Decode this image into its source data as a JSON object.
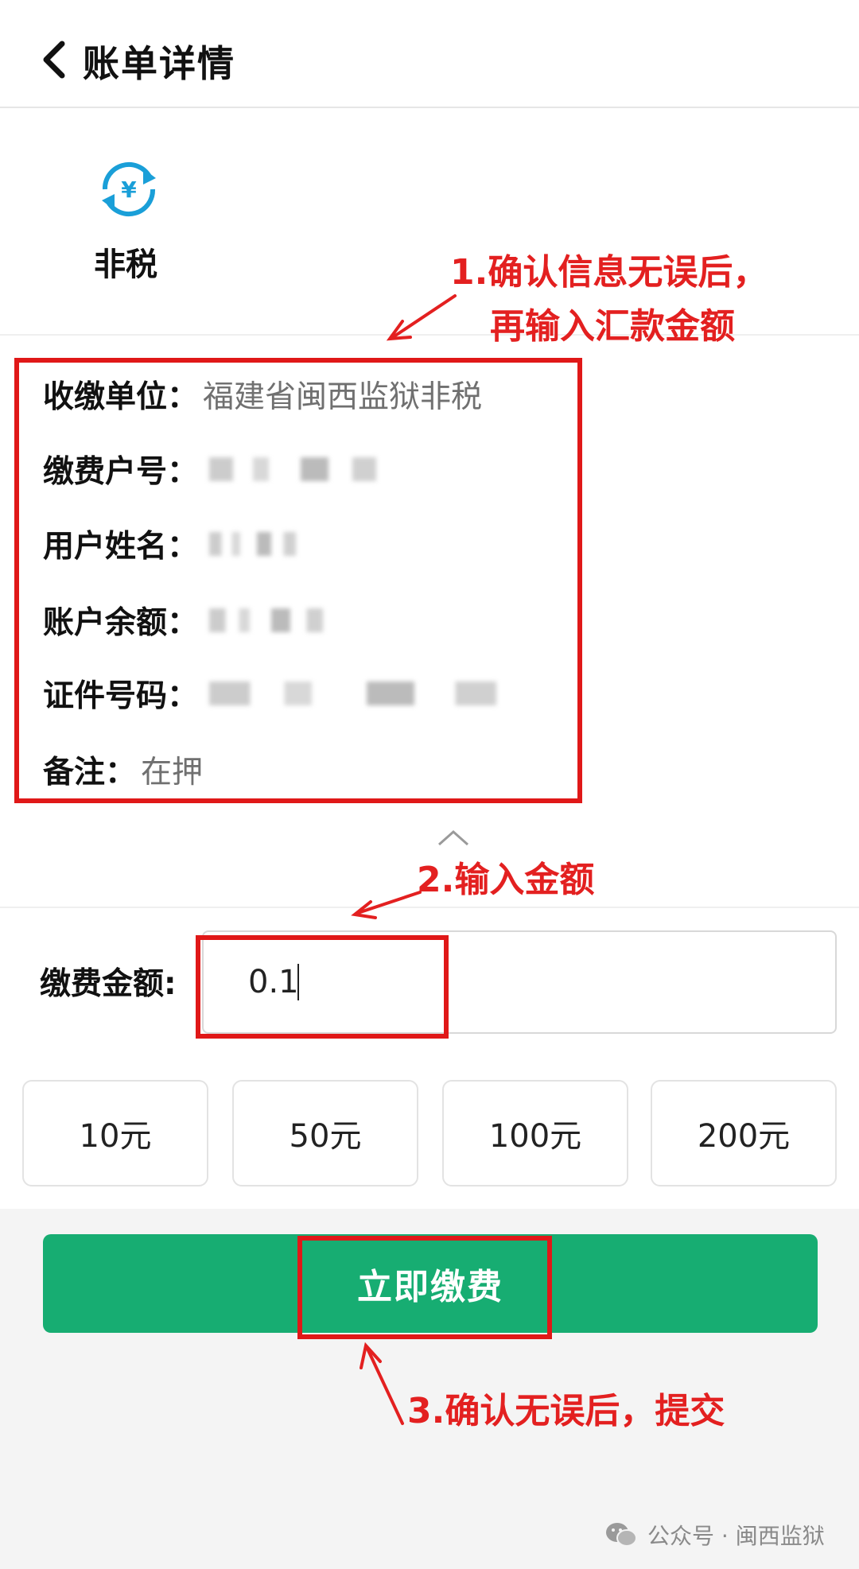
{
  "header": {
    "title": "账单详情",
    "back_icon": "chevron-left-icon"
  },
  "bill_type": {
    "label": "非税",
    "icon": "currency-exchange-icon",
    "icon_color": "#1a9fd8"
  },
  "annotations": {
    "note1_line1": "1.确认信息无误后，",
    "note1_line2": "再输入汇款金额",
    "note2": "2.输入金额",
    "note3": "3.确认无误后，提交",
    "color": "#e32020"
  },
  "info": {
    "unit_label": "收缴单位：",
    "unit_value": "福建省闽西监狱非税",
    "account_label": "缴费户号：",
    "name_label": "用户姓名：",
    "balance_label": "账户余额：",
    "id_label": "证件号码：",
    "remark_label": "备注：",
    "remark_value": "在押"
  },
  "amount": {
    "label": "缴费金额:",
    "value": "0.1"
  },
  "presets": [
    "10元",
    "50元",
    "100元",
    "200元"
  ],
  "pay_button": {
    "label": "立即缴费",
    "color": "#17ad72"
  },
  "watermark": {
    "text": "公众号 · 闽西监狱"
  }
}
